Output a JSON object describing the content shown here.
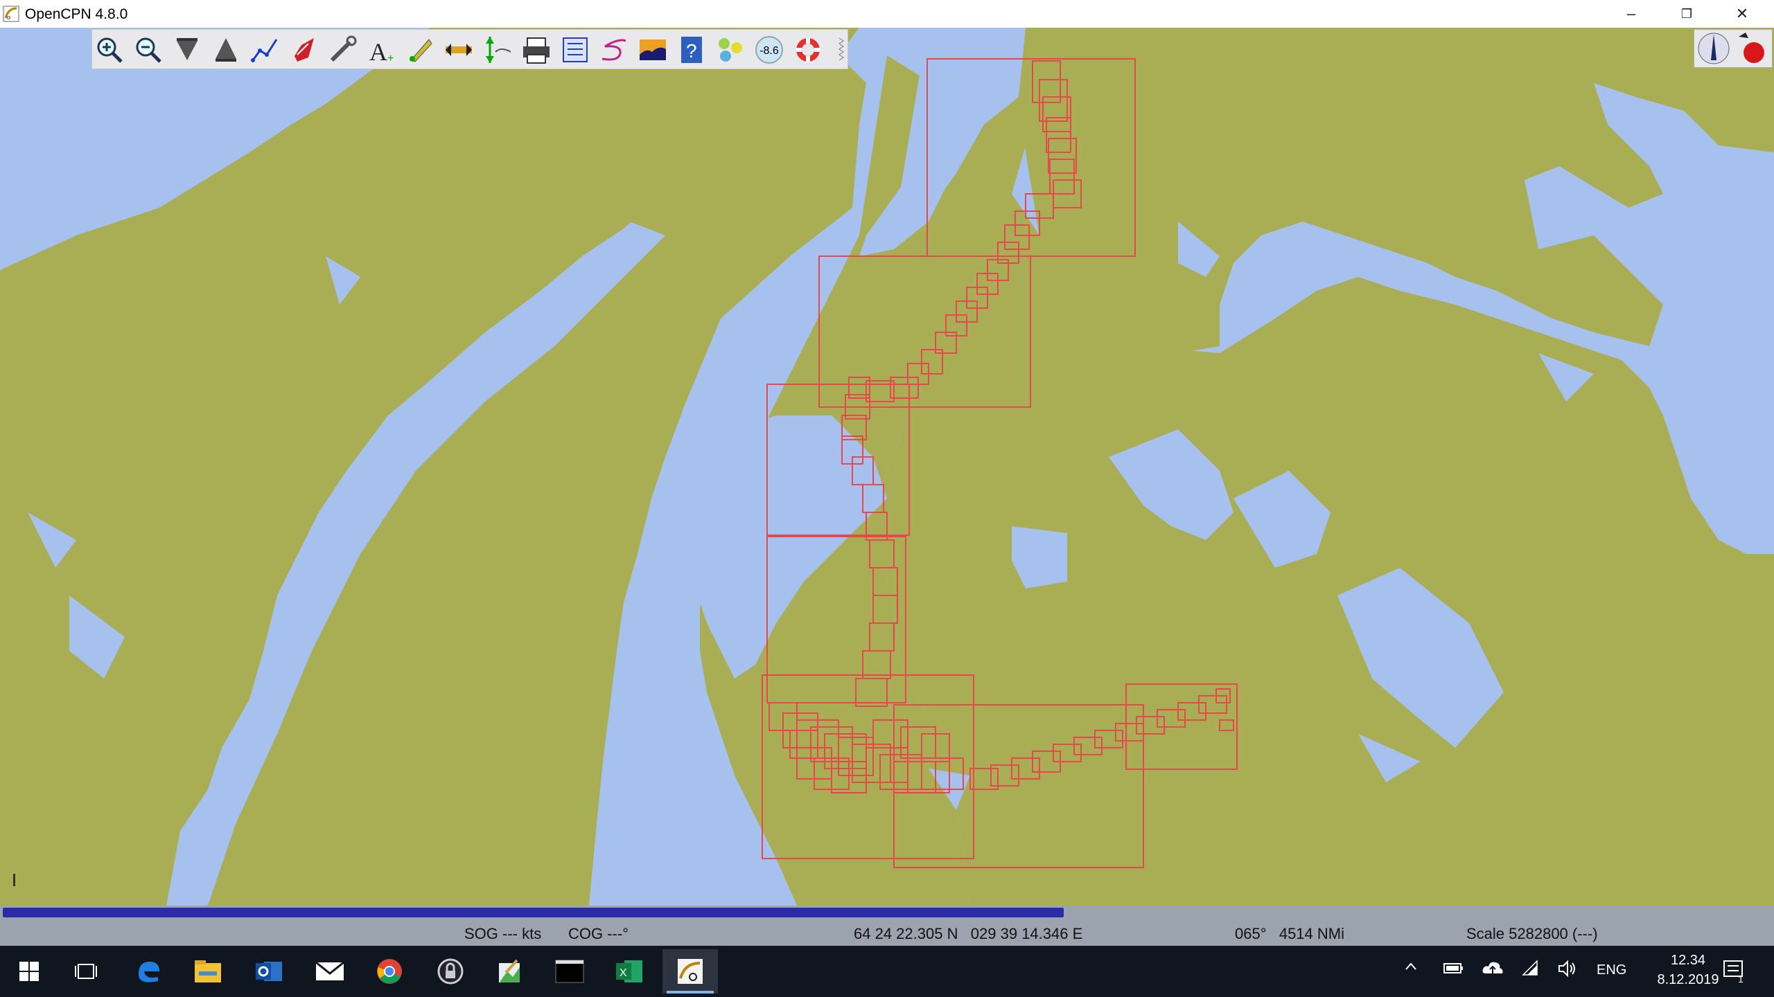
{
  "window": {
    "title": "OpenCPN 4.8.0",
    "controls": {
      "minimize": "–",
      "restore": "❐",
      "close": "✕"
    }
  },
  "toolbar": {
    "tools": [
      {
        "name": "zoom-in-icon"
      },
      {
        "name": "zoom-out-icon"
      },
      {
        "name": "scale-down-icon"
      },
      {
        "name": "scale-up-icon"
      },
      {
        "name": "route-icon"
      },
      {
        "name": "auto-follow-ship-icon"
      },
      {
        "name": "settings-icon"
      },
      {
        "name": "text-icon"
      },
      {
        "name": "mark-icon"
      },
      {
        "name": "measure-icon"
      },
      {
        "name": "tide-icon"
      },
      {
        "name": "print-icon"
      },
      {
        "name": "route-manager-icon"
      },
      {
        "name": "track-icon"
      },
      {
        "name": "color-scheme-icon"
      },
      {
        "name": "help-icon"
      },
      {
        "name": "ais-icon"
      },
      {
        "name": "zoom-level-icon",
        "label": "-8.6"
      },
      {
        "name": "mob-icon"
      }
    ]
  },
  "status": {
    "sog": "SOG --- kts",
    "cog": "COG ---°",
    "position": "64 24 22.305 N   029 39 14.346 E",
    "bearing_range": "065°   4514 NMi",
    "scale": "Scale 5282800 (---)"
  },
  "chart_load_progress": 0.6,
  "colors": {
    "land": "#a9ae55",
    "water": "#a6c1ee",
    "chart_outline": "#e8474e",
    "progress": "#2a2ba8"
  },
  "taskbar": {
    "apps": [
      "windows-start-icon",
      "task-view-icon",
      "edge-icon",
      "file-explorer-icon",
      "outlook-icon",
      "mail-icon",
      "chrome-icon",
      "keepass-icon",
      "paint-icon",
      "terminal-icon",
      "excel-icon",
      "opencpn-icon"
    ],
    "language": "ENG",
    "time": "12.34",
    "date": "8.12.2019",
    "notification_count": "1"
  }
}
